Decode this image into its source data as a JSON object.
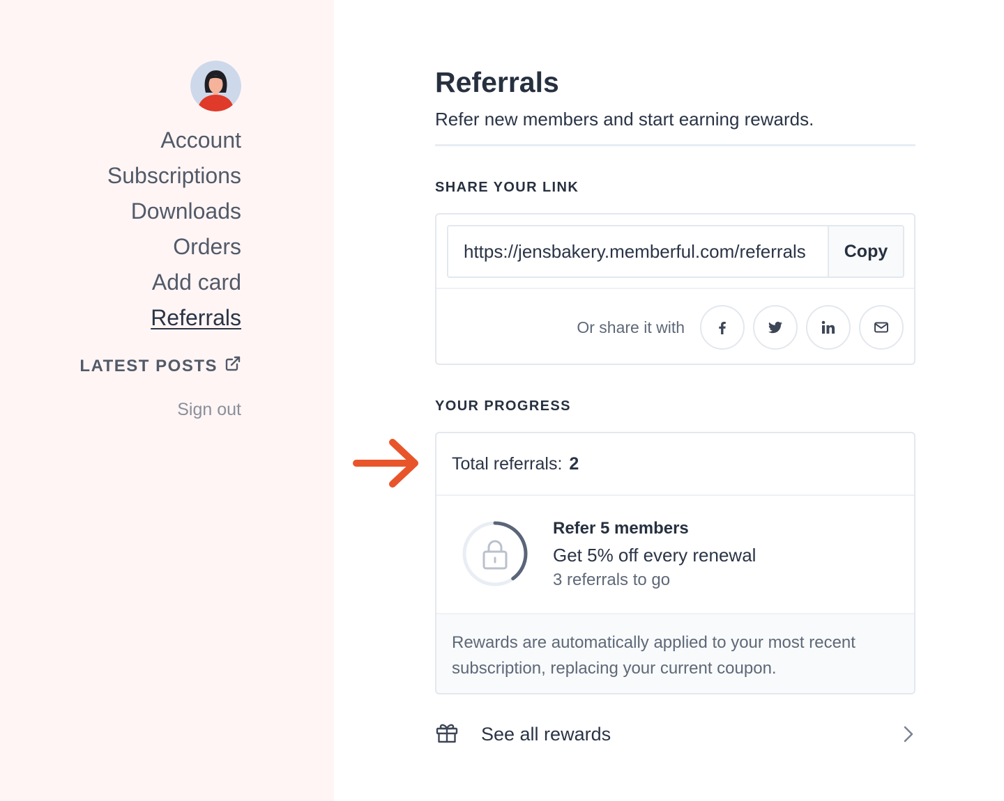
{
  "sidebar": {
    "nav_items": [
      {
        "label": "Account"
      },
      {
        "label": "Subscriptions"
      },
      {
        "label": "Downloads"
      },
      {
        "label": "Orders"
      },
      {
        "label": "Add card"
      },
      {
        "label": "Referrals",
        "active": true
      }
    ],
    "latest_posts_label": "LATEST POSTS",
    "latest_posts_icon": "external-link-icon",
    "sign_out_label": "Sign out"
  },
  "main": {
    "title": "Referrals",
    "subtitle": "Refer new members and start earning rewards.",
    "share": {
      "section_label": "SHARE YOUR LINK",
      "link_value": "https://jensbakery.memberful.com/referrals",
      "copy_label": "Copy",
      "share_text": "Or share it with",
      "share_icons": [
        "facebook-icon",
        "twitter-icon",
        "linkedin-icon",
        "email-icon"
      ]
    },
    "progress": {
      "section_label": "YOUR PROGRESS",
      "total_label": "Total referrals:",
      "total_value": "2",
      "reward_title": "Refer 5 members",
      "reward_description": "Get 5% off every renewal",
      "reward_remaining": "3 referrals to go",
      "progress_fraction": 0.4,
      "note": "Rewards are automatically applied to your most recent subscription, replacing your current coupon."
    },
    "see_all_rewards_label": "See all rewards"
  },
  "colors": {
    "sidebar_bg": "#fff5f5",
    "arrow": "#e8552b",
    "text_dark": "#27303f",
    "text_muted": "#5e6878",
    "border": "#e3e8ee"
  }
}
